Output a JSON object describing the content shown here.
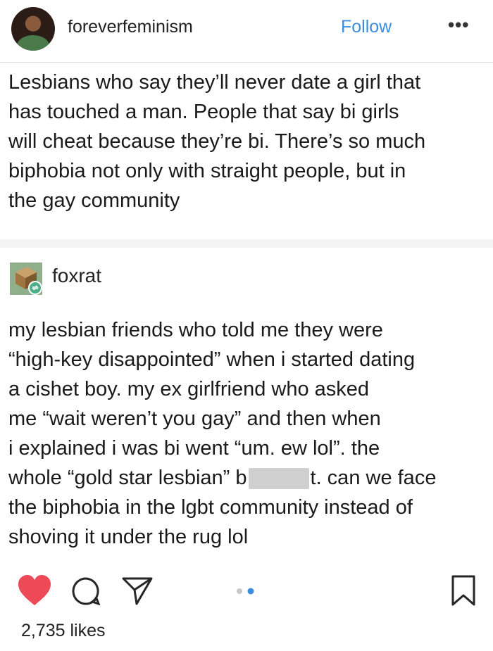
{
  "post": {
    "username": "foreverfeminism",
    "follow_label": "Follow",
    "more_label": "•••",
    "lines": [
      "Lesbians who say they’ll never date a girl that",
      "has touched a man. People that say bi girls",
      "will cheat because they’re bi. There’s so much",
      "biphobia not only with straight people, but in",
      "the gay community"
    ]
  },
  "reblog": {
    "username": "foxrat",
    "lines": [
      "my lesbian friends who told me they were",
      "“high-key disappointed” when i started dating",
      "a cishet boy. my ex girlfriend who asked",
      "me “wait weren’t you gay” and then when",
      "i explained i was bi went “um. ew lol”. the"
    ],
    "line6_before": "whole “gold star lesbian” b",
    "line6_after": "t. can we face",
    "lines_end": [
      "the biphobia in the lgbt community instead of",
      "shoving it under the rug lol"
    ]
  },
  "footer": {
    "likes": "2,735 likes",
    "icons": [
      "heart-icon",
      "comment-icon",
      "share-icon",
      "carousel-dots",
      "bookmark-icon"
    ],
    "colors": {
      "heart": "#ed4956",
      "dot_active": "#3d8ede",
      "dot_inactive": "#c8c8c8",
      "follow": "#3d8ede"
    }
  }
}
